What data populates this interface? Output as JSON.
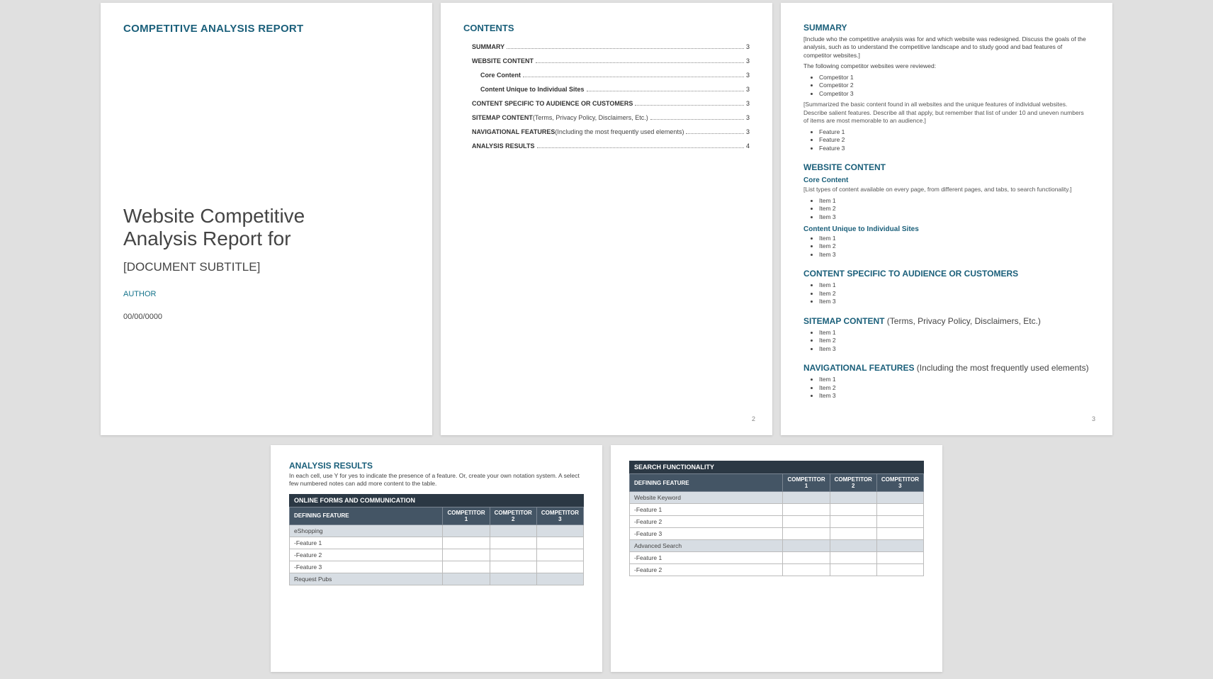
{
  "cover": {
    "header": "COMPETITIVE ANALYSIS REPORT",
    "title_line1": "Website Competitive",
    "title_line2": "Analysis Report for",
    "subtitle": "[DOCUMENT SUBTITLE]",
    "author": "AUTHOR",
    "date": "00/00/0000"
  },
  "toc": {
    "heading": "CONTENTS",
    "items": [
      {
        "label": "SUMMARY",
        "page": "3",
        "indent": 1,
        "bold": true,
        "note": ""
      },
      {
        "label": "WEBSITE CONTENT",
        "page": "3",
        "indent": 1,
        "bold": true,
        "note": ""
      },
      {
        "label": "Core Content",
        "page": "3",
        "indent": 2,
        "bold": true,
        "note": ""
      },
      {
        "label": "Content Unique to Individual Sites",
        "page": "3",
        "indent": 2,
        "bold": true,
        "note": ""
      },
      {
        "label": "CONTENT SPECIFIC TO AUDIENCE OR CUSTOMERS",
        "page": "3",
        "indent": 1,
        "bold": true,
        "note": ""
      },
      {
        "label": "SITEMAP CONTENT",
        "page": "3",
        "indent": 1,
        "bold": true,
        "note": " (Terms, Privacy Policy, Disclaimers, Etc.)"
      },
      {
        "label": "NAVIGATIONAL FEATURES",
        "page": "3",
        "indent": 1,
        "bold": true,
        "note": " (Including the most frequently used elements)"
      },
      {
        "label": "ANALYSIS RESULTS",
        "page": "4",
        "indent": 1,
        "bold": true,
        "note": ""
      }
    ],
    "page_number": "2"
  },
  "summary": {
    "heading": "SUMMARY",
    "intro": "[Include who the competitive analysis was for and which website was redesigned. Discuss the goals of the analysis, such as to understand the competitive landscape and to study good and bad features of competitor websites.]",
    "reviewed_lead": "The following competitor websites were reviewed:",
    "competitors": [
      "Competitor 1",
      "Competitor 2",
      "Competitor 3"
    ],
    "summarized": "[Summarized the basic content found in all websites and the unique features of individual websites. Describe salient features. Describe all that apply, but remember that list of under 10 and uneven numbers of items are most memorable to an audience.]",
    "features": [
      "Feature 1",
      "Feature 2",
      "Feature 3"
    ],
    "content_heading": "WEBSITE CONTENT",
    "core_heading": "Core Content",
    "core_note": "[List types of content available on every page, from different pages, and tabs, to search functionality.]",
    "core_items": [
      "Item 1",
      "Item 2",
      "Item 3"
    ],
    "unique_heading": "Content Unique to Individual Sites",
    "unique_items": [
      "Item 1",
      "Item 2",
      "Item 3"
    ],
    "audience_heading": "CONTENT SPECIFIC TO AUDIENCE OR CUSTOMERS",
    "audience_items": [
      "Item 1",
      "Item 2",
      "Item 3"
    ],
    "sitemap_heading": "SITEMAP CONTENT",
    "sitemap_note": " (Terms, Privacy Policy, Disclaimers, Etc.)",
    "sitemap_items": [
      "Item 1",
      "Item 2",
      "Item 3"
    ],
    "nav_heading": "NAVIGATIONAL FEATURES",
    "nav_note": " (Including the most frequently used elements)",
    "nav_items": [
      "Item 1",
      "Item 2",
      "Item 3"
    ],
    "page_number": "3"
  },
  "analysis": {
    "heading": "ANALYSIS RESULTS",
    "desc": "In each cell, use Y for yes to indicate the presence of a feature. Or, create your own notation system. A select few numbered notes can add more content to the table.",
    "table1": {
      "title": "ONLINE FORMS AND COMMUNICATION",
      "header_feature": "DEFINING FEATURE",
      "header_c1": "COMPETITOR 1",
      "header_c2": "COMPETITOR 2",
      "header_c3": "COMPETITOR 3",
      "rows": [
        {
          "label": "eShopping",
          "shaded": true
        },
        {
          "label": "-Feature 1",
          "shaded": false
        },
        {
          "label": "-Feature 2",
          "shaded": false
        },
        {
          "label": "-Feature 3",
          "shaded": false
        },
        {
          "label": "Request Pubs",
          "shaded": true
        }
      ]
    },
    "table2": {
      "title": "SEARCH FUNCTIONALITY",
      "header_feature": "DEFINING FEATURE",
      "header_c1": "COMPETITOR 1",
      "header_c2": "COMPETITOR 2",
      "header_c3": "COMPETITOR 3",
      "rows": [
        {
          "label": "Website Keyword",
          "shaded": true
        },
        {
          "label": "-Feature 1",
          "shaded": false
        },
        {
          "label": "-Feature 2",
          "shaded": false
        },
        {
          "label": "-Feature 3",
          "shaded": false
        },
        {
          "label": "Advanced Search",
          "shaded": true
        },
        {
          "label": "-Feature 1",
          "shaded": false
        },
        {
          "label": "-Feature 2",
          "shaded": false
        }
      ]
    }
  }
}
